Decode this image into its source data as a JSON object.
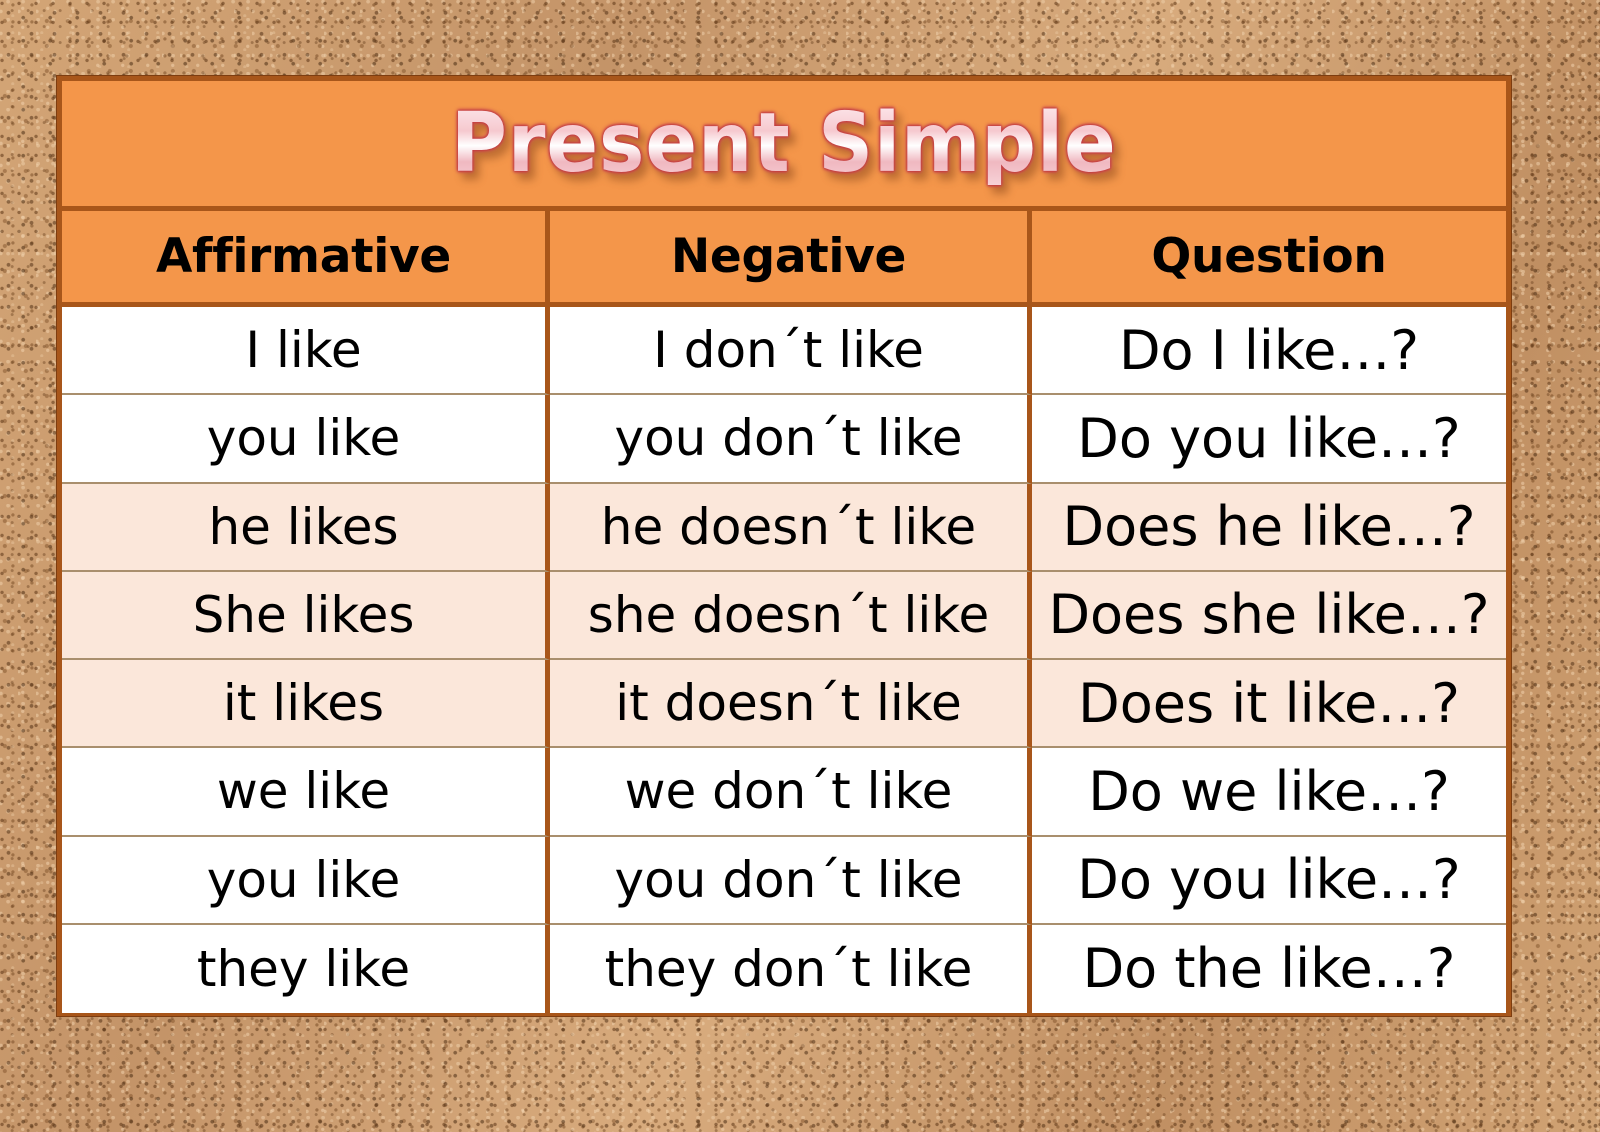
{
  "poster": {
    "title": "Present Simple",
    "background": "cork-board",
    "accent_orange": "#f4964a",
    "border_brown": "#a8561a",
    "shaded_row_color": "#fbe7da",
    "plain_row_color": "#ffffff",
    "title_outline_color": "#c23a3f",
    "title_fill_color": "#f6c9cf"
  },
  "chart_data": {
    "type": "table",
    "title": "Present Simple",
    "columns": [
      "Affirmative",
      "Negative",
      "Question"
    ],
    "rows": [
      {
        "shade": "white",
        "cells": [
          "I like",
          "I don´t like",
          "Do I like…?"
        ]
      },
      {
        "shade": "white",
        "cells": [
          "you like",
          "you don´t like",
          "Do you like…?"
        ]
      },
      {
        "shade": "peach",
        "cells": [
          "he likes",
          "he doesn´t like",
          "Does he like…?"
        ]
      },
      {
        "shade": "peach",
        "cells": [
          "She likes",
          "she doesn´t like",
          "Does she like…?"
        ]
      },
      {
        "shade": "peach",
        "cells": [
          "it likes",
          "it doesn´t like",
          "Does it like…?"
        ]
      },
      {
        "shade": "white",
        "cells": [
          "we like",
          "we don´t like",
          "Do we like…?"
        ]
      },
      {
        "shade": "white",
        "cells": [
          "you like",
          "you don´t like",
          "Do you like…?"
        ]
      },
      {
        "shade": "white",
        "cells": [
          "they like",
          "they don´t like",
          "Do the like…?"
        ]
      }
    ]
  }
}
